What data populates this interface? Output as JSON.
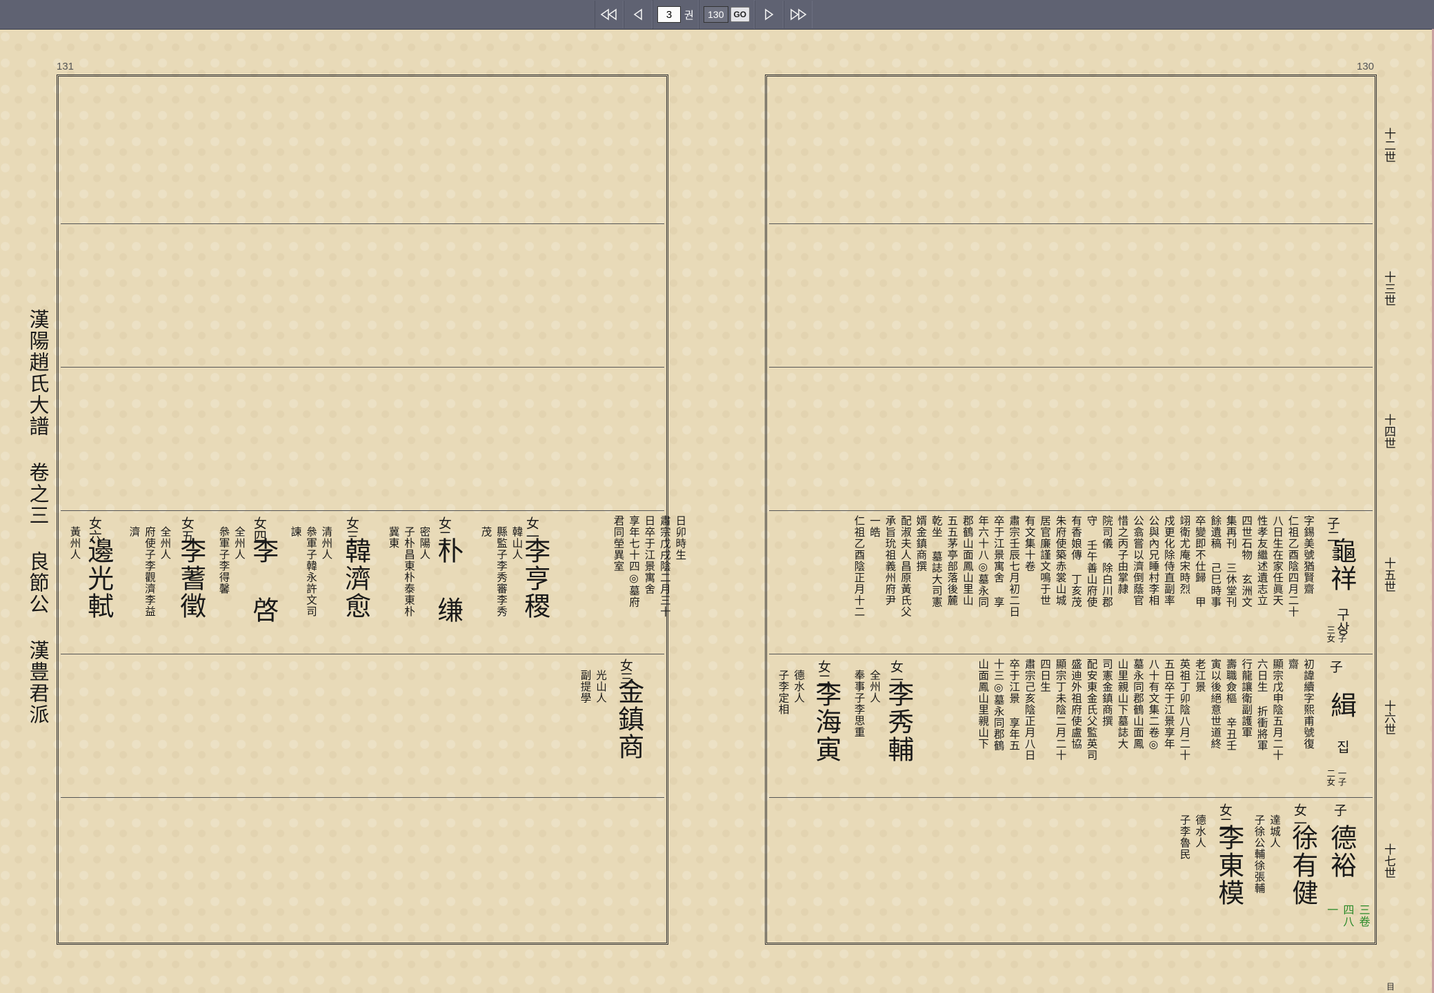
{
  "toolbar": {
    "first_label": "first",
    "prev_label": "prev",
    "page_value": "3",
    "page_unit": "권",
    "jump_value": "130",
    "go_label": "GO",
    "next_label": "next",
    "last_label": "last"
  },
  "pages": {
    "left_number": "131",
    "right_number": "130"
  },
  "book_title": "漢陽趙氏大譜 卷之三 良節公 漢豊君派",
  "generations": [
    "十二世",
    "十三世",
    "十四世",
    "十五世",
    "十六世",
    "十七世"
  ],
  "left_page": {
    "row4": [
      {
        "rel": "女一",
        "name": "李亨稷",
        "notes": [
          "日卯時生",
          "肅宗戊戌陰二月三十",
          "日卒于江景寓舍",
          "享年七十四◎墓府",
          "君同塋異室"
        ]
      },
      {
        "rel": "",
        "name": "",
        "notes": [
          "韓山人",
          "縣監子李秀審李秀",
          "茂"
        ]
      },
      {
        "rel": "女二",
        "name": "朴 缣",
        "notes": [
          "密陽人",
          "子朴昌東朴泰東朴",
          "冀東"
        ]
      },
      {
        "rel": "女三",
        "name": "韓濟愈",
        "notes": [
          "清州人",
          "叅軍子韓永許文司",
          "諫"
        ]
      },
      {
        "rel": "女四",
        "name": "李 啓",
        "notes": [
          "全州人",
          "叅軍子李得馨"
        ]
      },
      {
        "rel": "女五",
        "name": "李蓍徵",
        "notes": [
          "全州人",
          "府使子李觀濟李益",
          "濟"
        ]
      },
      {
        "rel": "女六",
        "name": "邊光軾",
        "notes": [
          "黃州人"
        ]
      }
    ],
    "row5": {
      "rel": "女三",
      "name": "金鎮商",
      "notes": [
        "光山人",
        "副提學"
      ]
    }
  },
  "right_page": {
    "row4": {
      "rel": "子二",
      "name": "龜祥",
      "reading": "구상",
      "children": "一子 三女",
      "notes": [
        "字錫美號猶賢齋",
        "仁祖乙酉陰四月二十",
        "八日生在家任眞天",
        "性孝友繼述遺志立",
        "四世石物 玄洲文",
        "集再刊 三休堂刊",
        "餘遺稿 己巳時事",
        "卒變即不仕歸 甲",
        "翊衛尤庵宋時烈",
        "戍更化除侍直副率",
        "公與內兄睡村李相",
        "公翕嘗以濟倒蔭官",
        "惜之丙子由掌隷",
        "院司儀 除白川郡",
        "守 壬午善山府使",
        "有香娘傳 丁亥茂",
        "朱府使築赤裳山城",
        "居官廉謹文鳴于世",
        "有文集十卷",
        "肅宗壬辰七月初二日",
        "卒于江景寓舍 享",
        "年六十八◎墓永同",
        "郡鶴山面鳳山里山",
        "五五茅亭部落後麓",
        "乾坐 墓誌大司憲",
        "婿金鎮商撰",
        "配淑夫人昌原黃氏父",
        "承旨玧祖義州府尹",
        "一皓",
        "仁祖乙酉陰正月十二"
      ]
    },
    "row5": [
      {
        "rel": "子",
        "name": "緝",
        "reading": "집",
        "children": "一子 二女",
        "notes": [
          "初諱續字熙甫號復",
          "齋",
          "顯宗戊申陰五月二十",
          "六日生 折衝將軍",
          "行龍讓衛副護軍",
          "壽職僉樞 辛丑壬",
          "寅以後絕意世道終",
          "老江景",
          "英祖丁卯陰八月二十",
          "五日卒于江景享年",
          "八十有文集二卷◎",
          "墓永同郡鶴山面鳳",
          "山里親山下墓誌大",
          "司憲金鎮商撰",
          "配安東金氏父監英司",
          "盛迪外祖府使盧協",
          "顯宗丁未陰二月二十",
          "四日生",
          "肅宗己亥陰正月八日",
          "卒于江景 享年五",
          "十三◎墓永同郡鶴",
          "山面鳳山里親山下"
        ]
      },
      {
        "rel": "女一",
        "name": "李秀輔",
        "notes": [
          "全州人",
          "奉事子李思重"
        ]
      },
      {
        "rel": "女二",
        "name": "李海寅",
        "notes": [
          "德水人",
          "子李定相"
        ]
      }
    ],
    "row6": [
      {
        "rel": "子",
        "name": "德裕",
        "notes": [
          "三卷",
          "四八一"
        ]
      },
      {
        "rel": "女一",
        "name": "徐有健",
        "notes": [
          "達城人",
          "子徐公輔徐張輔"
        ]
      },
      {
        "rel": "女二",
        "name": "李東模",
        "notes": [
          "德水人",
          "子李魯民"
        ]
      }
    ]
  },
  "corner_mark": "目"
}
